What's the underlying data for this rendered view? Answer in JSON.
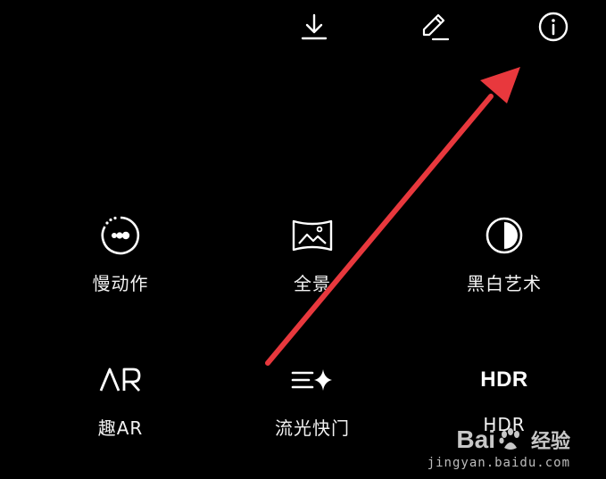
{
  "toolbar": {
    "download_icon": "download-icon",
    "edit_icon": "edit-pencil-icon",
    "info_icon": "info-icon"
  },
  "modes": [
    {
      "label": "慢动作",
      "icon": "slow-motion-icon"
    },
    {
      "label": "全景",
      "icon": "panorama-icon"
    },
    {
      "label": "黑白艺术",
      "icon": "monochrome-icon"
    },
    {
      "label": "趣AR",
      "icon": "ar-icon"
    },
    {
      "label": "流光快门",
      "icon": "light-painting-icon"
    },
    {
      "label": "HDR",
      "icon": "hdr-icon",
      "icon_text": "HDR"
    }
  ],
  "annotation": {
    "arrow_color": "#e8383d",
    "points_to": "info-icon"
  },
  "watermark": {
    "brand_prefix": "Bai",
    "brand_suffix": "经验",
    "url": "jingyan.baidu.com"
  },
  "colors": {
    "background": "#000000",
    "foreground": "#ffffff",
    "arrow": "#e8383d"
  }
}
